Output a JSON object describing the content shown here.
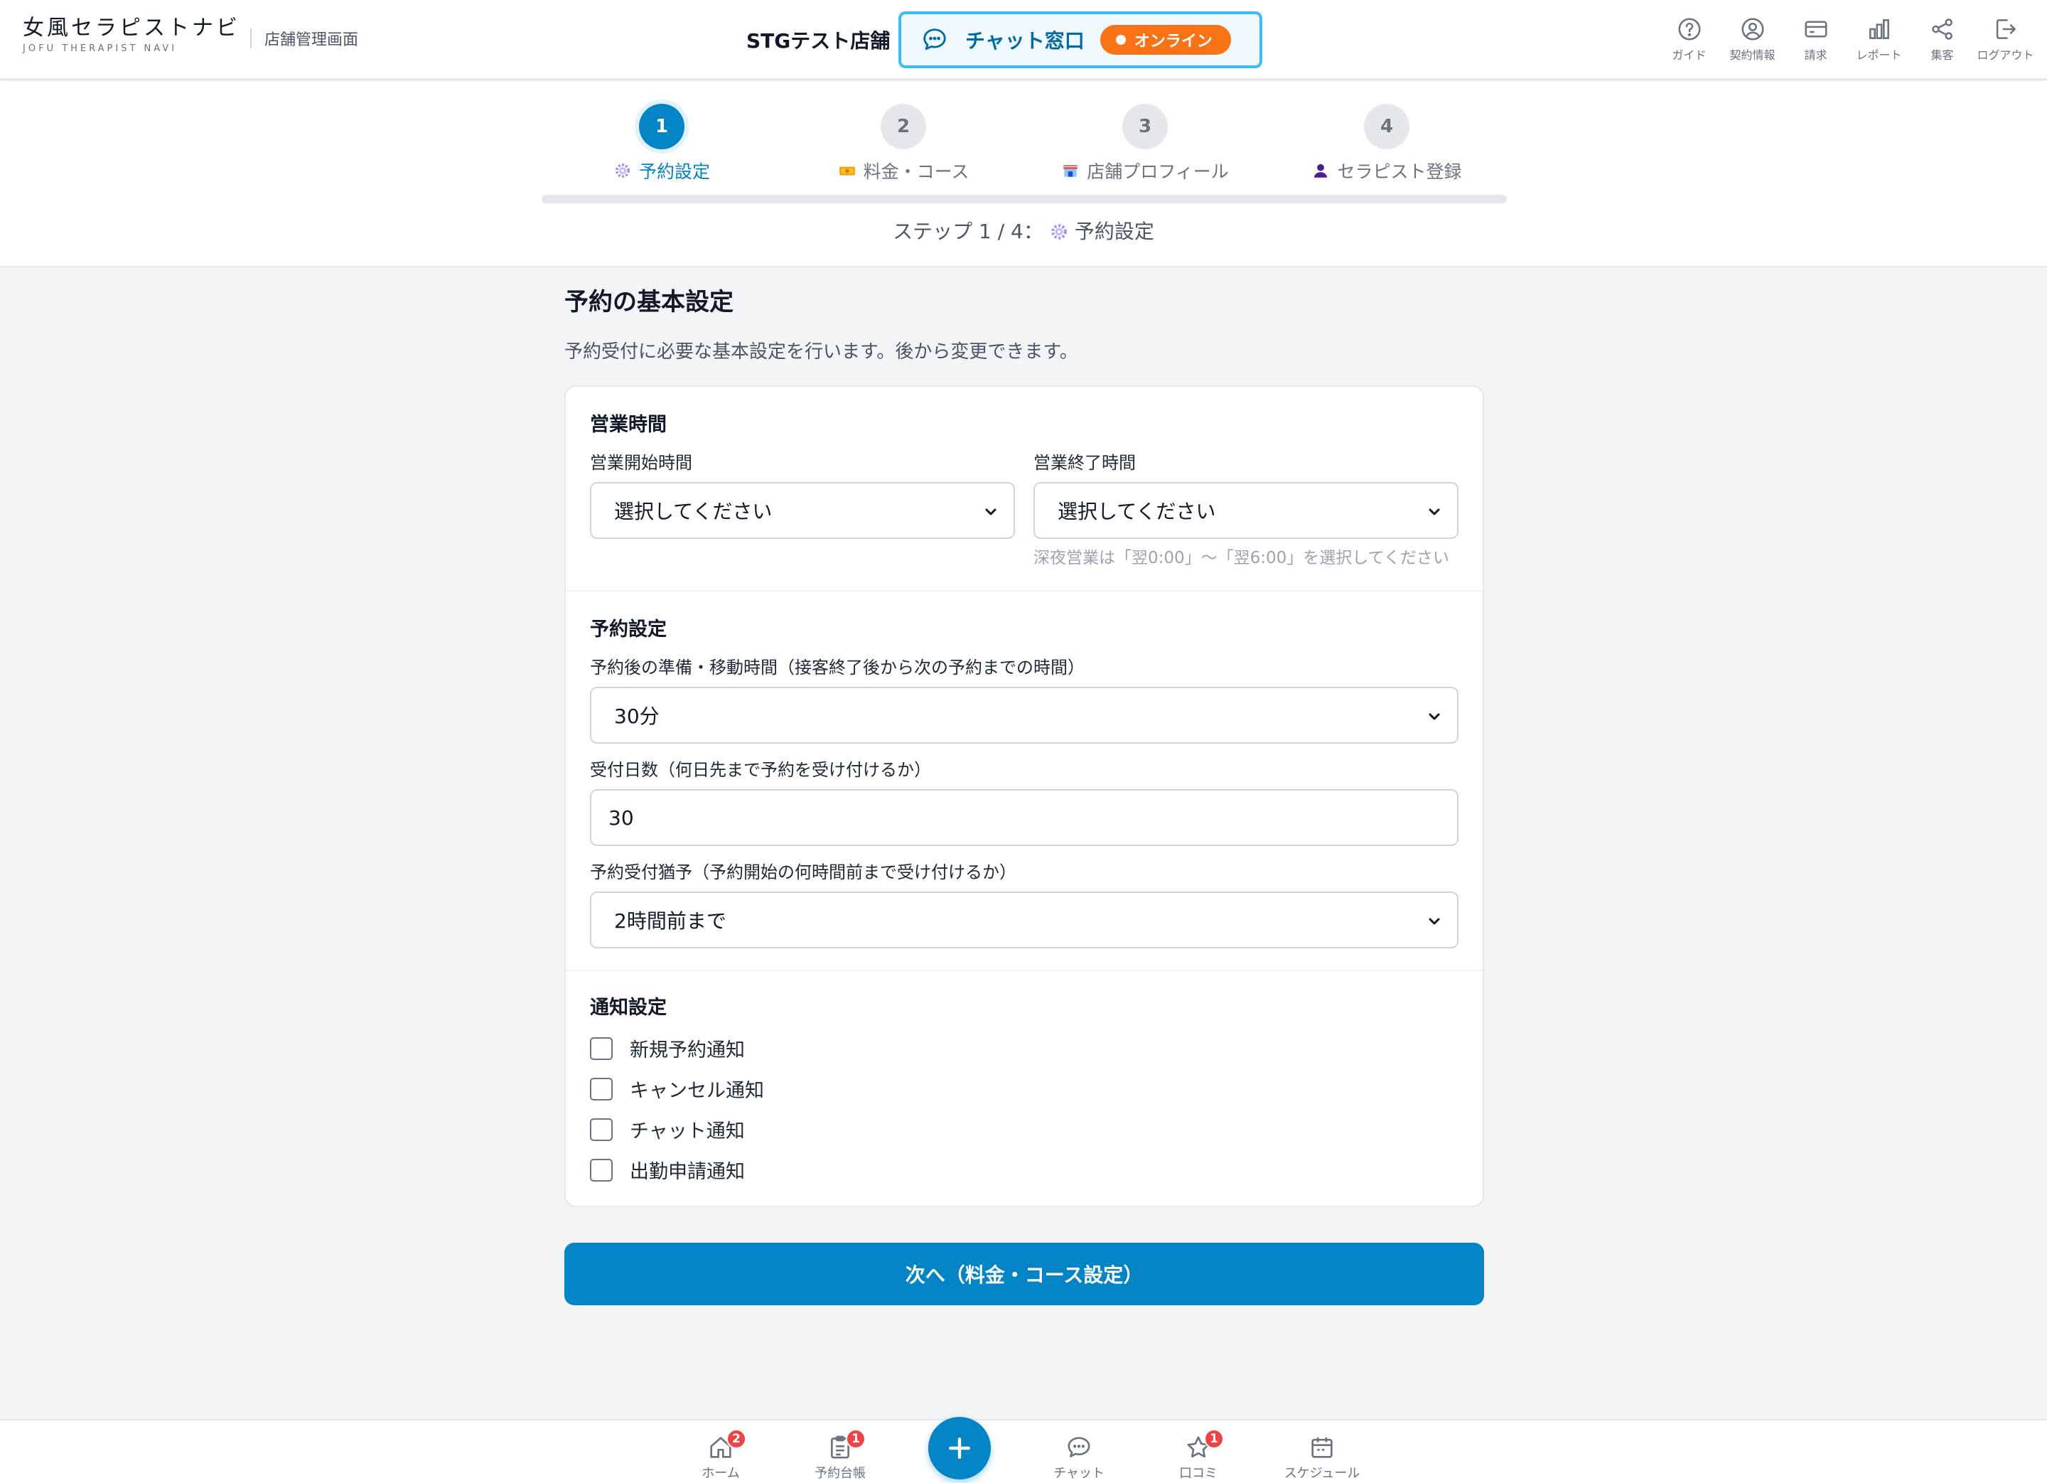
{
  "header": {
    "logo_main": "女風セラピストナビ",
    "logo_sub": "JOFU THERAPIST NAVI",
    "admin_label": "店舗管理画面",
    "store_name": "STGテスト店舗",
    "chat_window": {
      "label": "チャット窓口",
      "status": "オンライン",
      "status_color": "#f97316",
      "border_color": "#38bdf8"
    },
    "nav": [
      {
        "label": "ガイド",
        "icon": "help-circle-icon"
      },
      {
        "label": "契約情報",
        "icon": "user-circle-icon"
      },
      {
        "label": "請求",
        "icon": "credit-card-icon"
      },
      {
        "label": "レポート",
        "icon": "bar-chart-icon"
      },
      {
        "label": "集客",
        "icon": "share-icon"
      },
      {
        "label": "ログアウト",
        "icon": "logout-icon"
      }
    ]
  },
  "stepper": {
    "current": 1,
    "total": 4,
    "steps": [
      {
        "number": "1",
        "label": "予約設定",
        "icon": "gear-icon",
        "active": true
      },
      {
        "number": "2",
        "label": "料金・コース",
        "icon": "money-icon",
        "active": false
      },
      {
        "number": "3",
        "label": "店舗プロフィール",
        "icon": "store-icon",
        "active": false
      },
      {
        "number": "4",
        "label": "セラピスト登録",
        "icon": "person-icon",
        "active": false
      }
    ],
    "caption_prefix": "ステップ 1 / 4：",
    "caption_label": "予約設定"
  },
  "main": {
    "heading": "予約の基本設定",
    "description": "予約受付に必要な基本設定を行います。後から変更できます。",
    "business_hours": {
      "title": "営業時間",
      "start_label": "営業開始時間",
      "start_value": "選択してください",
      "end_label": "営業終了時間",
      "end_value": "選択してください",
      "end_hint": "深夜営業は「翌0:00」〜「翌6:00」を選択してください"
    },
    "reservation": {
      "title": "予約設定",
      "prep_label": "予約後の準備・移動時間（接客終了後から次の予約までの時間）",
      "prep_value": "30分",
      "days_label": "受付日数（何日先まで予約を受け付けるか）",
      "days_value": "30",
      "grace_label": "予約受付猶予（予約開始の何時間前まで受け付けるか）",
      "grace_value": "2時間前まで"
    },
    "notifications": {
      "title": "通知設定",
      "items": [
        {
          "label": "新規予約通知",
          "checked": false
        },
        {
          "label": "キャンセル通知",
          "checked": false
        },
        {
          "label": "チャット通知",
          "checked": false
        },
        {
          "label": "出勤申請通知",
          "checked": false
        }
      ]
    },
    "next_button": "次へ（料金・コース設定）",
    "accent_color": "#0284c7"
  },
  "bottom_nav": {
    "items": [
      {
        "label": "ホーム",
        "icon": "home-icon",
        "badge": "2"
      },
      {
        "label": "予約台帳",
        "icon": "clipboard-icon",
        "badge": "1"
      },
      {
        "label": "チャット",
        "icon": "chat-icon",
        "badge": ""
      },
      {
        "label": "口コミ",
        "icon": "star-icon",
        "badge": "1"
      },
      {
        "label": "スケジュール",
        "icon": "calendar-icon",
        "badge": ""
      }
    ],
    "fab_icon": "plus-icon"
  }
}
